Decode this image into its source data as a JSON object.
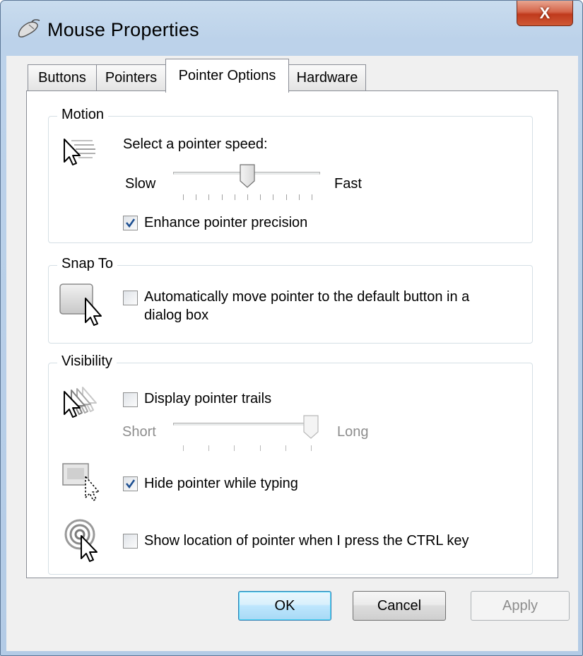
{
  "window": {
    "title": "Mouse Properties",
    "close_glyph": "X"
  },
  "tabs": [
    {
      "label": "Buttons"
    },
    {
      "label": "Pointers"
    },
    {
      "label": "Pointer Options"
    },
    {
      "label": "Hardware"
    }
  ],
  "motion": {
    "group_label": "Motion",
    "speed_label": "Select a pointer speed:",
    "slow_label": "Slow",
    "fast_label": "Fast",
    "speed_value": 0.5,
    "precision_label": "Enhance pointer precision",
    "precision_checked": true
  },
  "snap_to": {
    "group_label": "Snap To",
    "option_label_line1": "Automatically move pointer to the default button in a",
    "option_label_line2": "dialog box",
    "checked": false
  },
  "visibility": {
    "group_label": "Visibility",
    "trails_label": "Display pointer trails",
    "trails_checked": false,
    "short_label": "Short",
    "long_label": "Long",
    "trail_length_value": 1.0,
    "hide_label": "Hide pointer while typing",
    "hide_checked": true,
    "ctrl_label": "Show location of pointer when I press the CTRL key",
    "ctrl_checked": false
  },
  "buttons": {
    "ok": "OK",
    "cancel": "Cancel",
    "apply": "Apply"
  },
  "colors": {
    "accent": "#3c7fb1",
    "close_red": "#c0391c",
    "check_blue": "#1d4f91"
  }
}
